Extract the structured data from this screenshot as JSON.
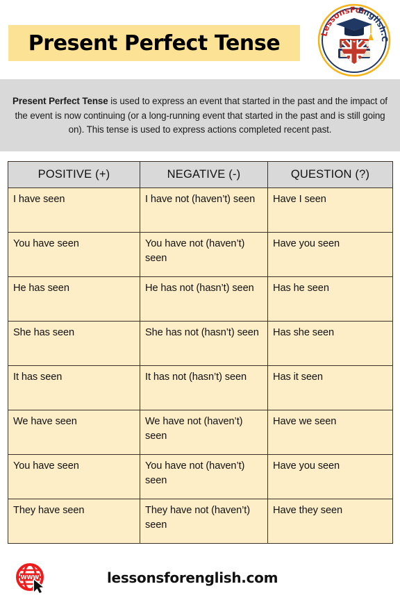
{
  "header": {
    "title": "Present Perfect Tense",
    "banner_color": "#fce295",
    "logo": {
      "name": "lessonsforenglish-logo",
      "text_left": "LessonsFor",
      "text_right": "English.Com",
      "ring_color": "#f5b317",
      "cap_color": "#1f3864",
      "book_red": "#c0392b",
      "book_navy": "#1f3864",
      "page_cream": "#e8e2cf",
      "flag_blue": "#1f3864",
      "flag_red": "#c0392b"
    }
  },
  "description": {
    "bold_lead": "Present Perfect Tense",
    "body": " is used to express an event that started in the past and the impact of the event is now continuing (or a long-running event that started in the past and is still going on). This tense is used to express actions completed recent past.",
    "background_color": "#d9d9d9"
  },
  "table": {
    "headers": [
      "POSITIVE  (+)",
      "NEGATIVE  (-)",
      "QUESTION  (?)"
    ],
    "header_background": "#d9d9d9",
    "cell_background": "#fdeec8",
    "border_color": "#3a3229",
    "rows": [
      {
        "positive": "I have seen",
        "negative": "I have not (haven’t) seen",
        "question": "Have I seen"
      },
      {
        "positive": "You have seen",
        "negative": "You have not (haven’t) seen",
        "question": "Have you seen"
      },
      {
        "positive": "He has seen",
        "negative": "He has not (hasn’t) seen",
        "question": "Has he seen"
      },
      {
        "positive": "She has seen",
        "negative": "She has not (hasn’t) seen",
        "question": "Has she seen"
      },
      {
        "positive": "It has seen",
        "negative": "It has not (hasn’t) seen",
        "question": "Has it seen"
      },
      {
        "positive": "We have seen",
        "negative": "We have not (haven’t) seen",
        "question": "Have we seen"
      },
      {
        "positive": "You have seen",
        "negative": "You have not (haven’t) seen",
        "question": "Have you seen"
      },
      {
        "positive": "They have seen",
        "negative": "They have not (haven’t) seen",
        "question": "Have they seen"
      }
    ]
  },
  "footer": {
    "website": "lessonsforenglish.com",
    "icon_name": "www-globe-icon",
    "icon_label": "WWW",
    "icon_color": "#ee1c1c"
  }
}
